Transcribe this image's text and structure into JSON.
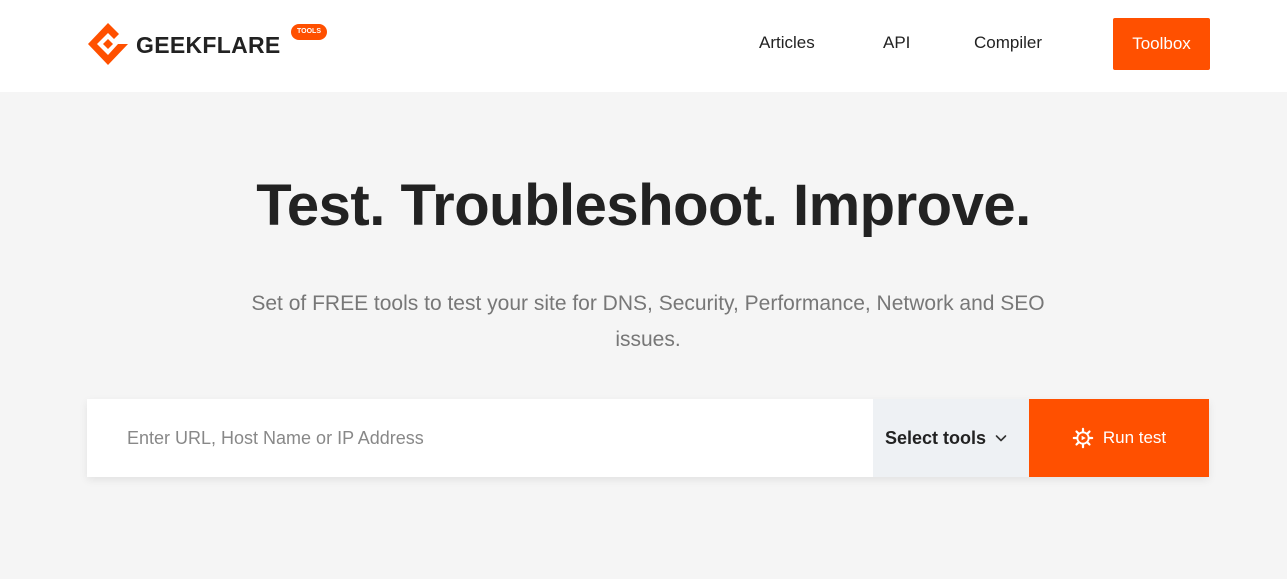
{
  "brand": {
    "name": "GEEKFLARE",
    "badge": "TOOLS",
    "accent_color": "#ff5000",
    "logo_icon": "geekflare-logo-icon"
  },
  "nav": {
    "links": [
      {
        "label": "Articles"
      },
      {
        "label": "API"
      },
      {
        "label": "Compiler"
      }
    ],
    "cta_label": "Toolbox"
  },
  "hero": {
    "title": "Test. Troubleshoot. Improve.",
    "subtitle": "Set of FREE tools to test your site for DNS, Security, Performance, Network and SEO issues."
  },
  "search": {
    "placeholder": "Enter URL, Host Name or IP Address",
    "value": "",
    "select_label": "Select tools",
    "select_icon": "chevron-down-icon",
    "run_label": "Run test",
    "run_icon": "gear-icon"
  }
}
